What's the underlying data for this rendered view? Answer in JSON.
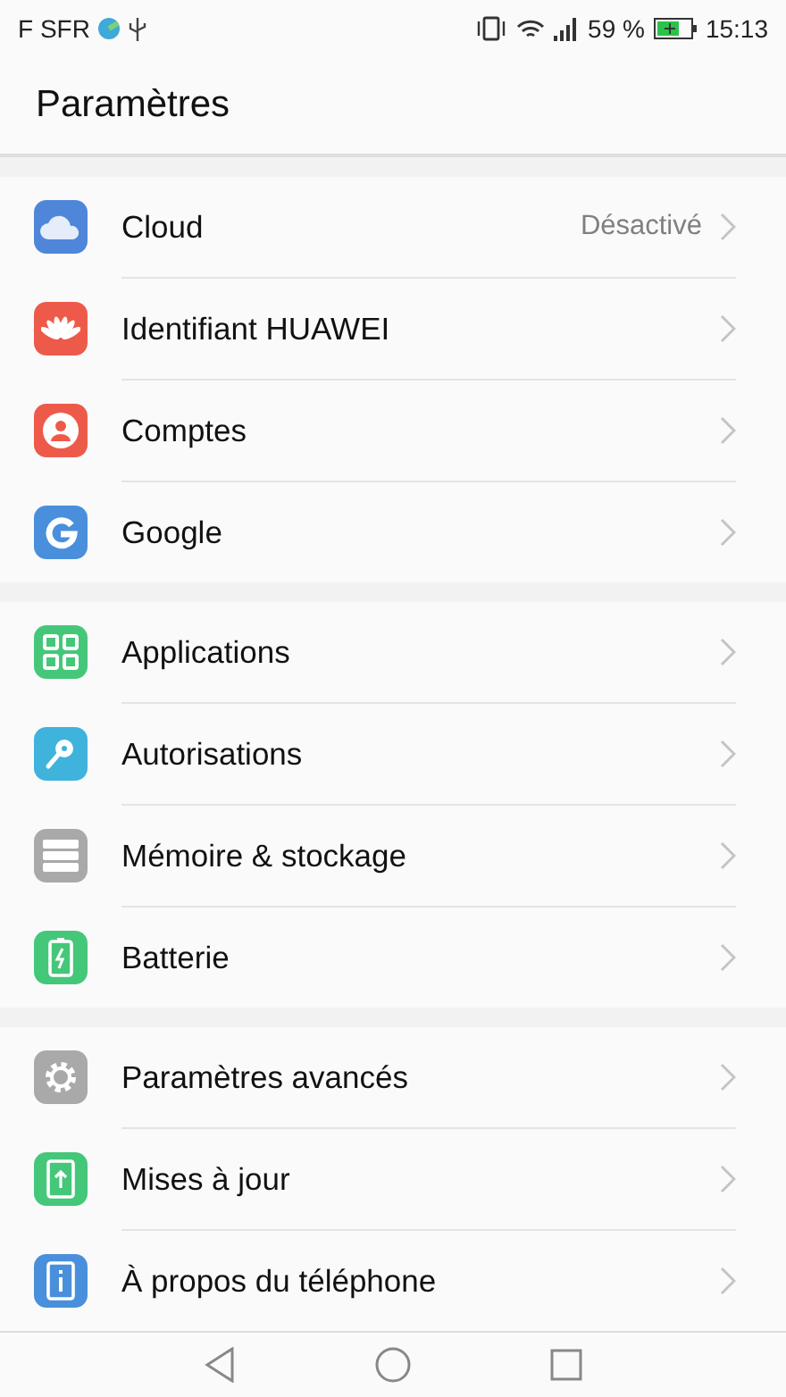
{
  "status_bar": {
    "carrier": "F SFR",
    "battery": "59 %",
    "time": "15:13"
  },
  "title": "Paramètres",
  "groups": [
    {
      "items": [
        {
          "kind": "cloud",
          "label": "Cloud",
          "value": "Désactivé",
          "color": "#4f86d9"
        },
        {
          "kind": "huawei",
          "label": "Identifiant HUAWEI",
          "color": "#ee5a4a"
        },
        {
          "kind": "account",
          "label": "Comptes",
          "color": "#ee5a4a"
        },
        {
          "kind": "google",
          "label": "Google",
          "color": "#4a8fdc"
        }
      ]
    },
    {
      "items": [
        {
          "kind": "apps",
          "label": "Applications",
          "color": "#45c779"
        },
        {
          "kind": "key",
          "label": "Autorisations",
          "color": "#3fb3dc"
        },
        {
          "kind": "storage",
          "label": "Mémoire & stockage",
          "color": "#a9a9a9"
        },
        {
          "kind": "battery",
          "label": "Batterie",
          "color": "#45c779"
        }
      ]
    },
    {
      "items": [
        {
          "kind": "gear",
          "label": "Paramètres avancés",
          "color": "#a9a9a9"
        },
        {
          "kind": "update",
          "label": "Mises à jour",
          "color": "#45c779"
        },
        {
          "kind": "info",
          "label": "À propos du téléphone",
          "color": "#4a8fdc"
        }
      ]
    }
  ]
}
